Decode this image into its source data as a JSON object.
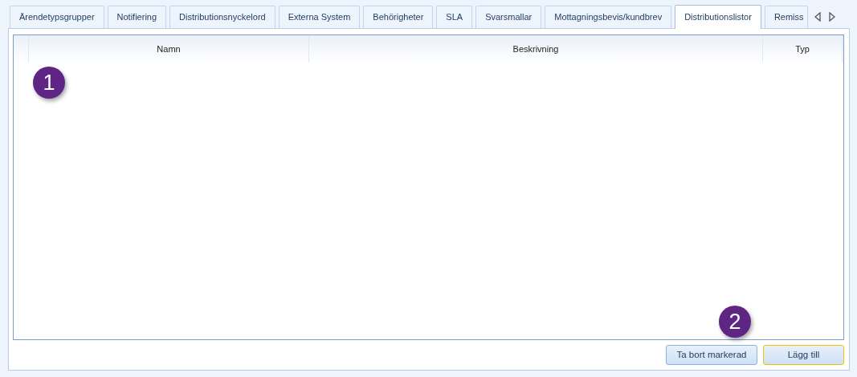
{
  "tabs": [
    {
      "label": "Ärendetypsgrupper",
      "selected": false
    },
    {
      "label": "Notifiering",
      "selected": false
    },
    {
      "label": "Distributionsnyckelord",
      "selected": false
    },
    {
      "label": "Externa System",
      "selected": false
    },
    {
      "label": "Behörigheter",
      "selected": false
    },
    {
      "label": "SLA",
      "selected": false
    },
    {
      "label": "Svarsmallar",
      "selected": false
    },
    {
      "label": "Mottagningsbevis/kundbrev",
      "selected": false
    },
    {
      "label": "Distributionslistor",
      "selected": true
    },
    {
      "label": "Remiss",
      "selected": false
    }
  ],
  "table": {
    "columns": [
      "Namn",
      "Beskrivning",
      "Typ"
    ]
  },
  "buttons": [
    {
      "label": "Ta bort markerad",
      "focused": false
    },
    {
      "label": "Lägg till",
      "focused": true
    }
  ],
  "callouts": [
    "1",
    "2"
  ]
}
